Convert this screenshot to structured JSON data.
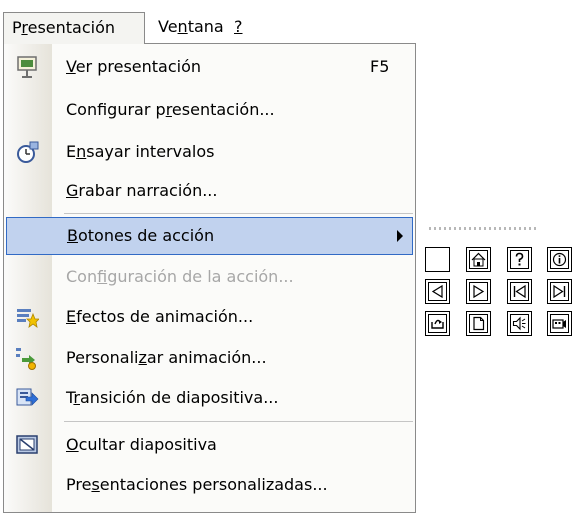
{
  "menubar": {
    "items": [
      {
        "pre": "P",
        "key": "r",
        "post": "esentación"
      },
      {
        "pre": "Ve",
        "key": "n",
        "post": "tana"
      },
      {
        "pre": "",
        "key": "?",
        "post": ""
      }
    ]
  },
  "menu": {
    "items": [
      {
        "pre": "",
        "key": "V",
        "post": "er presentación",
        "shortcut": "F5",
        "icon": "slide-show-icon"
      },
      {
        "pre": "Configurar p",
        "key": "r",
        "post": "esentación..."
      },
      {
        "pre": "E",
        "key": "n",
        "post": "sayar intervalos",
        "icon": "rehearse-timings-icon"
      },
      {
        "pre": "",
        "key": "G",
        "post": "rabar narración..."
      },
      {
        "pre": "",
        "key": "B",
        "post": "otones de acción"
      },
      {
        "pre": "Con",
        "key": "f",
        "post": "iguración de la acción..."
      },
      {
        "pre": "",
        "key": "E",
        "post": "fectos de animación...",
        "icon": "animation-effects-icon"
      },
      {
        "pre": "Personali",
        "key": "z",
        "post": "ar animación...",
        "icon": "custom-animation-icon"
      },
      {
        "pre": "T",
        "key": "r",
        "post": "ansición de diapositiva...",
        "icon": "slide-transition-icon"
      },
      {
        "pre": "",
        "key": "O",
        "post": "cultar diapositiva",
        "icon": "hide-slide-icon"
      },
      {
        "pre": "Pre",
        "key": "s",
        "post": "entaciones personalizadas..."
      }
    ]
  },
  "colors": {
    "highlight_fill": "#c1d2ee",
    "highlight_border": "#316ac5",
    "disabled_text": "#a7a7a7",
    "menu_background": "#fbfbf9"
  },
  "action_buttons": [
    "custom-button-icon",
    "home-button-icon",
    "help-button-icon",
    "information-button-icon",
    "back-button-icon",
    "forward-button-icon",
    "beginning-button-icon",
    "end-button-icon",
    "return-button-icon",
    "document-button-icon",
    "sound-button-icon",
    "movie-button-icon"
  ]
}
